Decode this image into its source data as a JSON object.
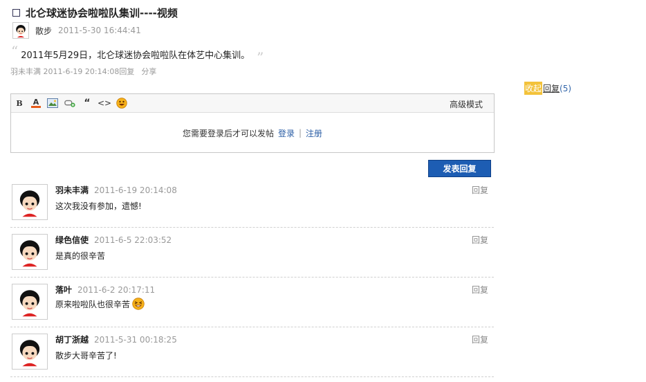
{
  "post": {
    "title": "北仑球迷协会啦啦队集训----视频",
    "author": "散步",
    "time": "2011-5-30 16:44:41",
    "quote": "2011年5月29日，北仑球迷协会啦啦队在体艺中心集训。",
    "quote_open": "“",
    "quote_close": "”",
    "last_meta": "羽未丰满 2011-6-19 20:14:08回复",
    "share": "分享"
  },
  "collapse": {
    "label": "收起",
    "reply": "回复",
    "count": "(5)"
  },
  "editor": {
    "bold": "B",
    "font_color": "A",
    "quote": "“",
    "code": "<>",
    "advanced": "高级模式",
    "prompt": "您需要登录后才可以发帖",
    "login": "登录",
    "sep": "|",
    "register": "注册"
  },
  "submit_label": "发表回复",
  "replies": [
    {
      "user": "羽未丰满",
      "time": "2011-6-19 20:14:08",
      "text": "这次我没有参加，遗憾!",
      "action": "回复"
    },
    {
      "user": "绿色信使",
      "time": "2011-6-5 22:03:52",
      "text": "是真的很辛苦",
      "action": "回复"
    },
    {
      "user": "落叶",
      "time": "2011-6-2 20:17:11",
      "text": "原来啦啦队也很辛苦",
      "action": "回复"
    },
    {
      "user": "胡丁浙越",
      "time": "2011-5-31 00:18:25",
      "text": "散步大哥辛苦了!",
      "action": "回复"
    }
  ],
  "colors": {
    "accent": "#1d5db3",
    "collapse_bg": "#f3c23a",
    "link": "#2b5ea5"
  }
}
